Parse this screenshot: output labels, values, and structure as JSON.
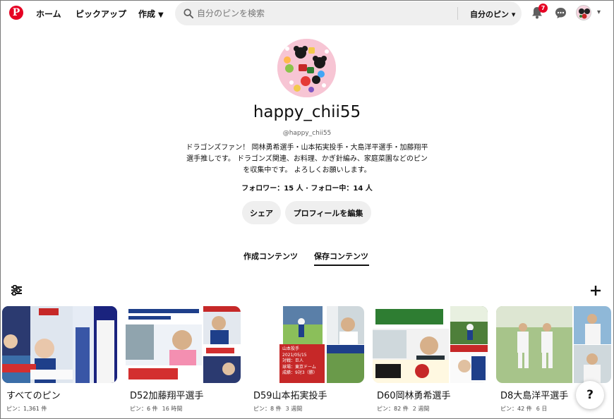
{
  "header": {
    "home": "ホーム",
    "explore": "ピックアップ",
    "create": "作成",
    "search_placeholder": "自分のピンを検索",
    "search_scope": "自分のピン",
    "notifications_count": "7",
    "accent_color": "#e60023"
  },
  "profile": {
    "name": "happy_chii55",
    "handle": "@happy_chii55",
    "bio": "ドラゴンズファン！ 岡林勇希選手・山本拓実投手・大島洋平選手・加藤翔平選手推しです。 ドラゴンズ関連、お料理、かぎ針編み、家庭菜園などのピンを収集中です。 よろしくお願いします。",
    "stats": "フォロワー：15 人 · フォロー中：14 人",
    "share_label": "シェア",
    "edit_label": "プロフィールを編集"
  },
  "tabs": {
    "created": "作成コンテンツ",
    "saved": "保存コンテンツ",
    "active": "saved"
  },
  "boards": [
    {
      "title": "すべてのピン",
      "count": "ピン：1,361 件",
      "age": ""
    },
    {
      "title": "D52加藤翔平選手",
      "count": "ピン：6 件",
      "age": "16 時間"
    },
    {
      "title": "D59山本拓実投手",
      "count": "ピン：8 件",
      "age": "3 週間"
    },
    {
      "title": "D60岡林勇希選手",
      "count": "ピン：82 件",
      "age": "2 週間"
    },
    {
      "title": "D8大島洋平選手",
      "count": "ピン：42 件",
      "age": "6 日"
    }
  ],
  "board_cover_text": {
    "b3_sub2_lines": [
      "山本投手",
      "2021/05/15",
      "対戦：巨人",
      "球場：東京ドーム",
      "成績：9対3（勝）"
    ]
  },
  "help_label": "?"
}
